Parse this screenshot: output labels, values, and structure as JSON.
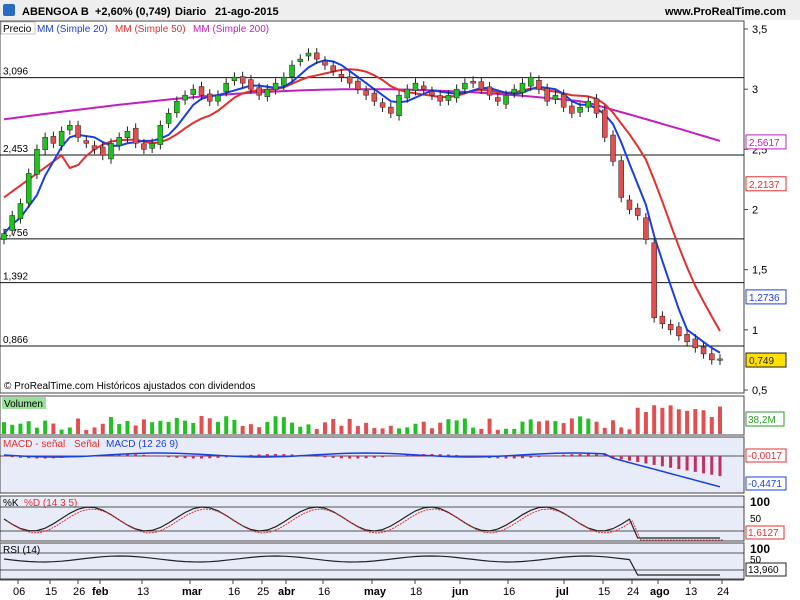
{
  "header": {
    "ticker": "ABENGOA B",
    "change": "+2,60% (0,749)",
    "period": "Diario",
    "date": "21-ago-2015",
    "site": "www.ProRealTime.com"
  },
  "legend": {
    "price": "Precio",
    "mm20": "MM (Simple 20)",
    "mm50": "MM (Simple 50)",
    "mm200": "MM (Simple 200)"
  },
  "watermark": "© ProRealTime.com  Históricos ajustados con dividendos",
  "colors": {
    "up": "#22c022",
    "down": "#e05050",
    "mm20": "#1a3fe0",
    "mm50": "#e03030",
    "mm200": "#c020c0",
    "grid_bg": "#ffffff",
    "indicator_bg": "#e8ecf8"
  },
  "chart_data": [
    {
      "type": "candlestick",
      "title": "ABENGOA B",
      "ylim": [
        0.5,
        3.5
      ],
      "y_ticks": [
        "3,5",
        "3",
        "2,5",
        "2",
        "1,5",
        "1",
        "0,5"
      ],
      "x_ticks": [
        "06",
        "15",
        "26",
        "feb",
        "13",
        "mar",
        "16",
        "25",
        "abr",
        "16",
        "may",
        "18",
        "jun",
        "16",
        "jul",
        "15",
        "24",
        "ago",
        "13",
        "24"
      ],
      "levels": [
        "3,096",
        "2,453",
        "1,756",
        "1,392",
        "0,866"
      ],
      "last_values": {
        "mm200": "2,5617",
        "mm50": "2,2137",
        "mm20": "1,2736",
        "price": "0,749"
      },
      "close": [
        1.8,
        1.95,
        2.05,
        2.3,
        2.5,
        2.6,
        2.55,
        2.65,
        2.7,
        2.6,
        2.55,
        2.5,
        2.45,
        2.55,
        2.6,
        2.65,
        2.55,
        2.5,
        2.55,
        2.7,
        2.8,
        2.9,
        2.95,
        3.0,
        2.95,
        2.9,
        2.95,
        3.05,
        3.1,
        3.05,
        3.0,
        2.95,
        3.0,
        3.05,
        3.1,
        3.2,
        3.25,
        3.3,
        3.25,
        3.2,
        3.15,
        3.1,
        3.05,
        3.0,
        2.95,
        2.9,
        2.85,
        2.8,
        2.95,
        3.0,
        3.05,
        3.0,
        2.95,
        2.9,
        2.95,
        3.0,
        3.05,
        3.05,
        3.0,
        2.95,
        2.9,
        2.95,
        3.0,
        3.05,
        3.1,
        3.0,
        2.9,
        2.95,
        2.85,
        2.8,
        2.85,
        2.9,
        2.8,
        2.6,
        2.4,
        2.1,
        2.0,
        1.95,
        1.75,
        1.1,
        1.05,
        1.0,
        0.95,
        0.9,
        0.85,
        0.8,
        0.75,
        0.749
      ]
    },
    {
      "type": "bar",
      "title": "Volumen",
      "last_label": "38,2M"
    },
    {
      "type": "line",
      "title": "MACD",
      "series_labels": [
        "MACD - señal",
        "Señal",
        "MACD (12 26 9)"
      ],
      "last_values": [
        "-0,0017",
        "-0,4471"
      ]
    },
    {
      "type": "line",
      "title": "%K %D (14 3 5)",
      "series_labels": [
        "%K",
        "%D (14 3 5)"
      ],
      "y_ticks": [
        "100",
        "50"
      ],
      "last_value": "1,6127"
    },
    {
      "type": "line",
      "title": "RSI (14)",
      "y_ticks": [
        "100",
        "50"
      ],
      "last_value": "13,960"
    }
  ]
}
